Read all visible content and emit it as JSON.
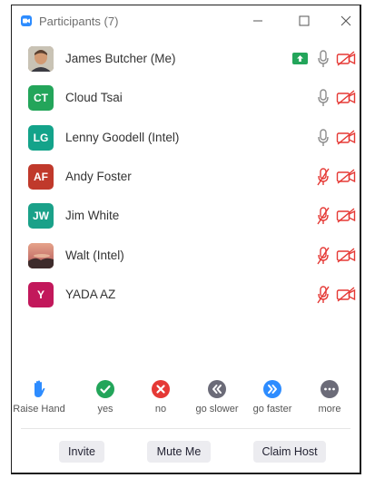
{
  "window": {
    "title": "Participants (7)"
  },
  "participants": [
    {
      "name": "James Butcher (Me)",
      "initials": "",
      "avatar_type": "photo-person",
      "avatar_color": "#8a6a4a",
      "sharing": true,
      "audio": "on",
      "video": "off"
    },
    {
      "name": "Cloud Tsai",
      "initials": "CT",
      "avatar_type": "initials",
      "avatar_color": "#23a55a",
      "sharing": false,
      "audio": "on",
      "video": "off"
    },
    {
      "name": "Lenny Goodell (Intel)",
      "initials": "LG",
      "avatar_type": "initials",
      "avatar_color": "#13a38a",
      "sharing": false,
      "audio": "on",
      "video": "off"
    },
    {
      "name": "Andy Foster",
      "initials": "AF",
      "avatar_type": "initials",
      "avatar_color": "#c0392b",
      "sharing": false,
      "audio": "muted",
      "video": "off"
    },
    {
      "name": "Jim White",
      "initials": "JW",
      "avatar_type": "initials",
      "avatar_color": "#1aa189",
      "sharing": false,
      "audio": "muted",
      "video": "off"
    },
    {
      "name": "Walt (Intel)",
      "initials": "",
      "avatar_type": "photo-sunset",
      "avatar_color": "#d9825b",
      "sharing": false,
      "audio": "muted",
      "video": "off"
    },
    {
      "name": "YADA AZ",
      "initials": "Y",
      "avatar_type": "initials",
      "avatar_color": "#c2185b",
      "sharing": false,
      "audio": "muted",
      "video": "off"
    }
  ],
  "reactions": [
    {
      "label": "Raise Hand",
      "icon": "raise-hand-icon",
      "color": "#2d8cff"
    },
    {
      "label": "yes",
      "icon": "check-icon",
      "color": "#23a55a"
    },
    {
      "label": "no",
      "icon": "x-icon",
      "color": "#e53935"
    },
    {
      "label": "go slower",
      "icon": "rewind-icon",
      "color": "#6b6b78"
    },
    {
      "label": "go faster",
      "icon": "fast-forward-icon",
      "color": "#2d8cff"
    },
    {
      "label": "more",
      "icon": "more-icon",
      "color": "#6b6b78"
    }
  ],
  "buttons": {
    "invite": "Invite",
    "mute_me": "Mute Me",
    "claim_host": "Claim Host"
  }
}
